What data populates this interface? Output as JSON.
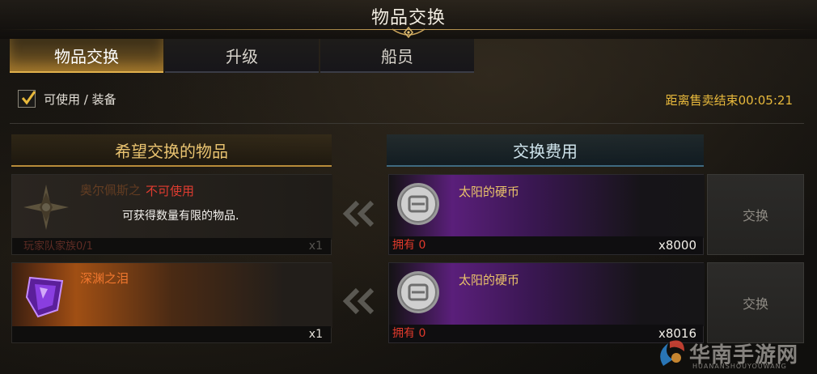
{
  "window": {
    "title": "物品交换"
  },
  "tabs": [
    {
      "label": "物品交换",
      "active": true
    },
    {
      "label": "升级",
      "active": false
    },
    {
      "label": "船员",
      "active": false
    }
  ],
  "filter": {
    "checked": true,
    "label": "可使用 / 装备"
  },
  "sale_timer": "距离售卖结束00:05:21",
  "sections": {
    "wanted": "希望交换的物品",
    "cost": "交换费用"
  },
  "rows": [
    {
      "item": {
        "name": "奥尔佩斯之",
        "qty": "x1",
        "limit": "玩家队家族0/1",
        "tooltip_tag": "不可使用",
        "tooltip_text": "可获得数量有限的物品.",
        "icon": "compass-star-icon",
        "name_color": "#e0742c"
      },
      "cost": {
        "name": "太阳的硬币",
        "owned": "拥有 0",
        "qty": "x8000",
        "icon": "silver-coin-icon"
      },
      "button": "交换"
    },
    {
      "item": {
        "name": "深渊之泪",
        "qty": "x1",
        "icon": "purple-gem-icon",
        "name_color": "#f0772e"
      },
      "cost": {
        "name": "太阳的硬币",
        "owned": "拥有 0",
        "qty": "x8016",
        "icon": "silver-coin-icon"
      },
      "button": "交换"
    }
  ],
  "watermark": {
    "text": "华南手游网",
    "sub": "HUANANSHOUYOUWANG"
  },
  "colors": {
    "accent_gold": "#e0b04c",
    "timer": "#e8b93c",
    "warning_red": "#e03c30",
    "cost_purple": "#5a1f7a"
  }
}
